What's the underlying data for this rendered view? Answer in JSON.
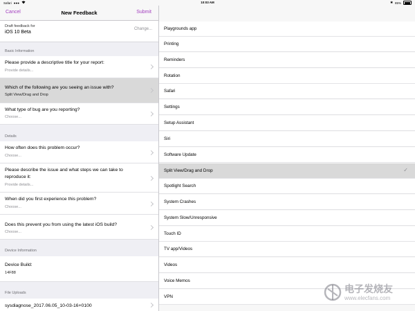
{
  "status_bar": {
    "carrier": "Safari",
    "signal": "●●●",
    "wifi_icon": "wifi-icon",
    "time": "10:03 AM",
    "bluetooth": "✱",
    "battery_text": "85%"
  },
  "nav": {
    "cancel_label": "Cancel",
    "title": "New Feedback",
    "submit_label": "Submit"
  },
  "draft": {
    "caption": "Draft feedback for",
    "name": "iOS 10 Beta",
    "change_label": "Change..."
  },
  "sections": {
    "basic_information": "Basic Information",
    "details": "Details",
    "device_information": "Device Information",
    "file_uploads": "File Uploads"
  },
  "basic": [
    {
      "title": "Please provide a descriptive title for your report:",
      "value": "Provide details..."
    },
    {
      "title": "Which of the following are you seeing an issue with?",
      "value": "Split View/Drag and Drop"
    },
    {
      "title": "What type of bug are you reporting?",
      "value": "Choose..."
    }
  ],
  "details": [
    {
      "title": "How often does this problem occur?",
      "value": "Choose..."
    },
    {
      "title": "Please describe the issue and what steps we can take to reproduce it:",
      "value": "Provide details..."
    },
    {
      "title": "When did you first experience this problem?",
      "value": "Choose..."
    },
    {
      "title": "Does this prevent you from using the latest iOS build?",
      "value": "Choose..."
    }
  ],
  "device": {
    "title": "Device Build:",
    "value": "14F88"
  },
  "uploads": {
    "file_name": "sysdiagnose_2017.06.05_10-03-16+0100"
  },
  "options": [
    "Playgrounds app",
    "Printing",
    "Reminders",
    "Rotation",
    "Safari",
    "Settings",
    "Setup Assistant",
    "Siri",
    "Software Update",
    "Split View/Drag and Drop",
    "Spotlight Search",
    "System Crashes",
    "System Slow/Unresponsive",
    "Touch ID",
    "TV app/Videos",
    "Videos",
    "Voice Memos",
    "VPN"
  ],
  "selected_option": "Split View/Drag and Drop",
  "checkmark": "✓",
  "watermark": {
    "text": "电子发烧友",
    "url": "www.elecfans.com"
  },
  "colors": {
    "accent": "#a23dbf",
    "selected_row": "#d9d9d9",
    "grouped_bg": "#efeff4"
  }
}
